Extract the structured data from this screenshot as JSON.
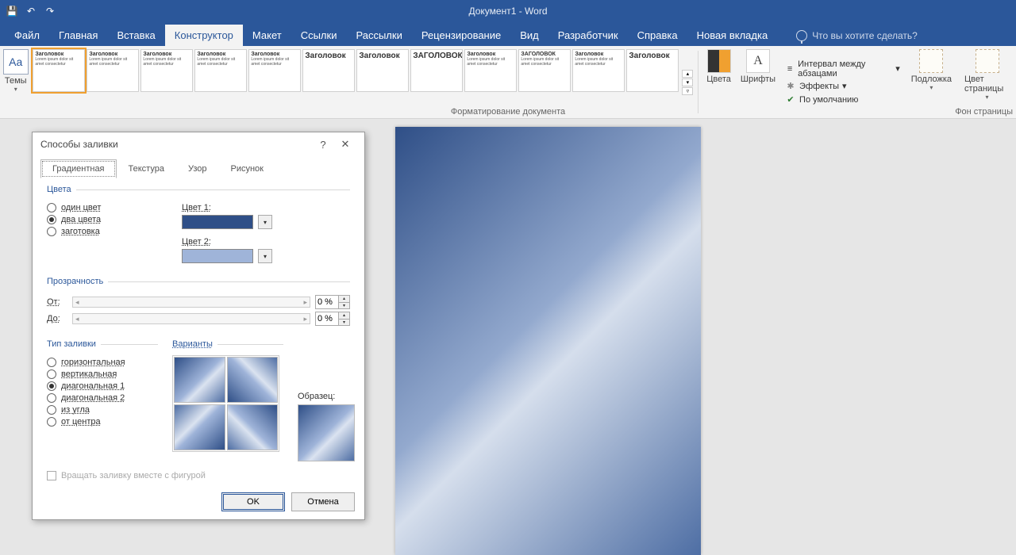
{
  "titlebar": {
    "title": "Документ1 - Word"
  },
  "qat": {
    "save": "💾",
    "undo": "↶",
    "redo": "↷"
  },
  "menu": {
    "items": [
      "Файл",
      "Главная",
      "Вставка",
      "Конструктор",
      "Макет",
      "Ссылки",
      "Рассылки",
      "Рецензирование",
      "Вид",
      "Разработчик",
      "Справка",
      "Новая вкладка"
    ],
    "active_index": 3,
    "tell_me": "Что вы хотите сделать?"
  },
  "ribbon": {
    "themes_label": "Темы",
    "styles": [
      "Заголовок",
      "Заголовок",
      "Заголовок",
      "Заголовок",
      "Заголовок",
      "Заголовок",
      "Заголовок",
      "ЗАГОЛОВОК",
      "Заголовок",
      "ЗАГОЛОВОК",
      "Заголовок",
      "Заголовок"
    ],
    "colors_label": "Цвета",
    "fonts_label": "Шрифты",
    "fonts_glyph": "A",
    "opts": {
      "spacing": "Интервал между абзацами",
      "effects": "Эффекты",
      "default": "По умолчанию"
    },
    "watermark": "Подложка",
    "page_color": "Цвет страницы",
    "group_doc": "Форматирование документа",
    "group_bg": "Фон страницы"
  },
  "dialog": {
    "title": "Способы заливки",
    "help": "?",
    "close": "✕",
    "tabs": [
      "Градиентная",
      "Текстура",
      "Узор",
      "Рисунок"
    ],
    "active_tab": 0,
    "colors": {
      "legend": "Цвета",
      "one": "один цвет",
      "two": "два цвета",
      "preset": "заготовка",
      "selected": "two",
      "c1_label": "Цвет 1:",
      "c2_label": "Цвет 2:",
      "c1": "#2f4f87",
      "c2": "#9fb4d9"
    },
    "transparency": {
      "legend": "Прозрачность",
      "from_label": "От:",
      "to_label": "До:",
      "from_value": "0 %",
      "to_value": "0 %"
    },
    "shading": {
      "legend": "Тип заливки",
      "opts": [
        "горизонтальная",
        "вертикальная",
        "диагональная 1",
        "диагональная 2",
        "из угла",
        "от центра"
      ],
      "selected_index": 2
    },
    "variants": {
      "legend": "Варианты"
    },
    "sample_label": "Образец:",
    "rotate_label": "Вращать заливку вместе с фигурой",
    "ok": "OK",
    "cancel": "Отмена"
  }
}
